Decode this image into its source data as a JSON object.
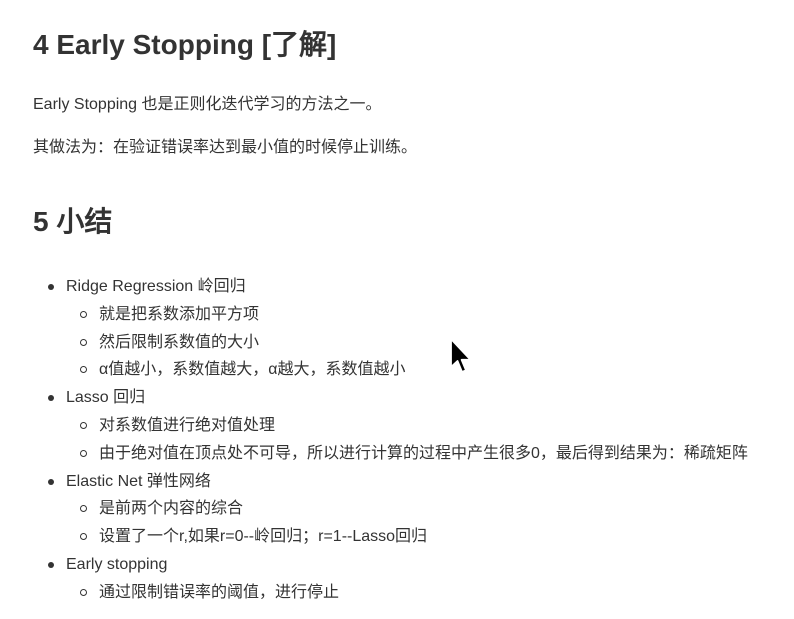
{
  "sections": {
    "early_stopping": {
      "heading": "4 Early Stopping [了解]",
      "paragraph1": "Early Stopping 也是正则化迭代学习的方法之一。",
      "paragraph2": "其做法为：在验证错误率达到最小值的时候停止训练。"
    },
    "summary": {
      "heading": "5 小结",
      "items": [
        {
          "label": "Ridge Regression 岭回归",
          "subitems": [
            "就是把系数添加平方项",
            "然后限制系数值的大小",
            "α值越小，系数值越大，α越大，系数值越小"
          ]
        },
        {
          "label": "Lasso 回归",
          "subitems": [
            "对系数值进行绝对值处理",
            "由于绝对值在顶点处不可导，所以进行计算的过程中产生很多0，最后得到结果为：稀疏矩阵"
          ]
        },
        {
          "label": "Elastic Net 弹性网络",
          "subitems": [
            "是前两个内容的综合",
            "设置了一个r,如果r=0--岭回归；r=1--Lasso回归"
          ]
        },
        {
          "label": "Early stopping",
          "subitems": [
            "通过限制错误率的阈值，进行停止"
          ]
        }
      ]
    }
  },
  "cursor_icon": "mouse-pointer-icon"
}
